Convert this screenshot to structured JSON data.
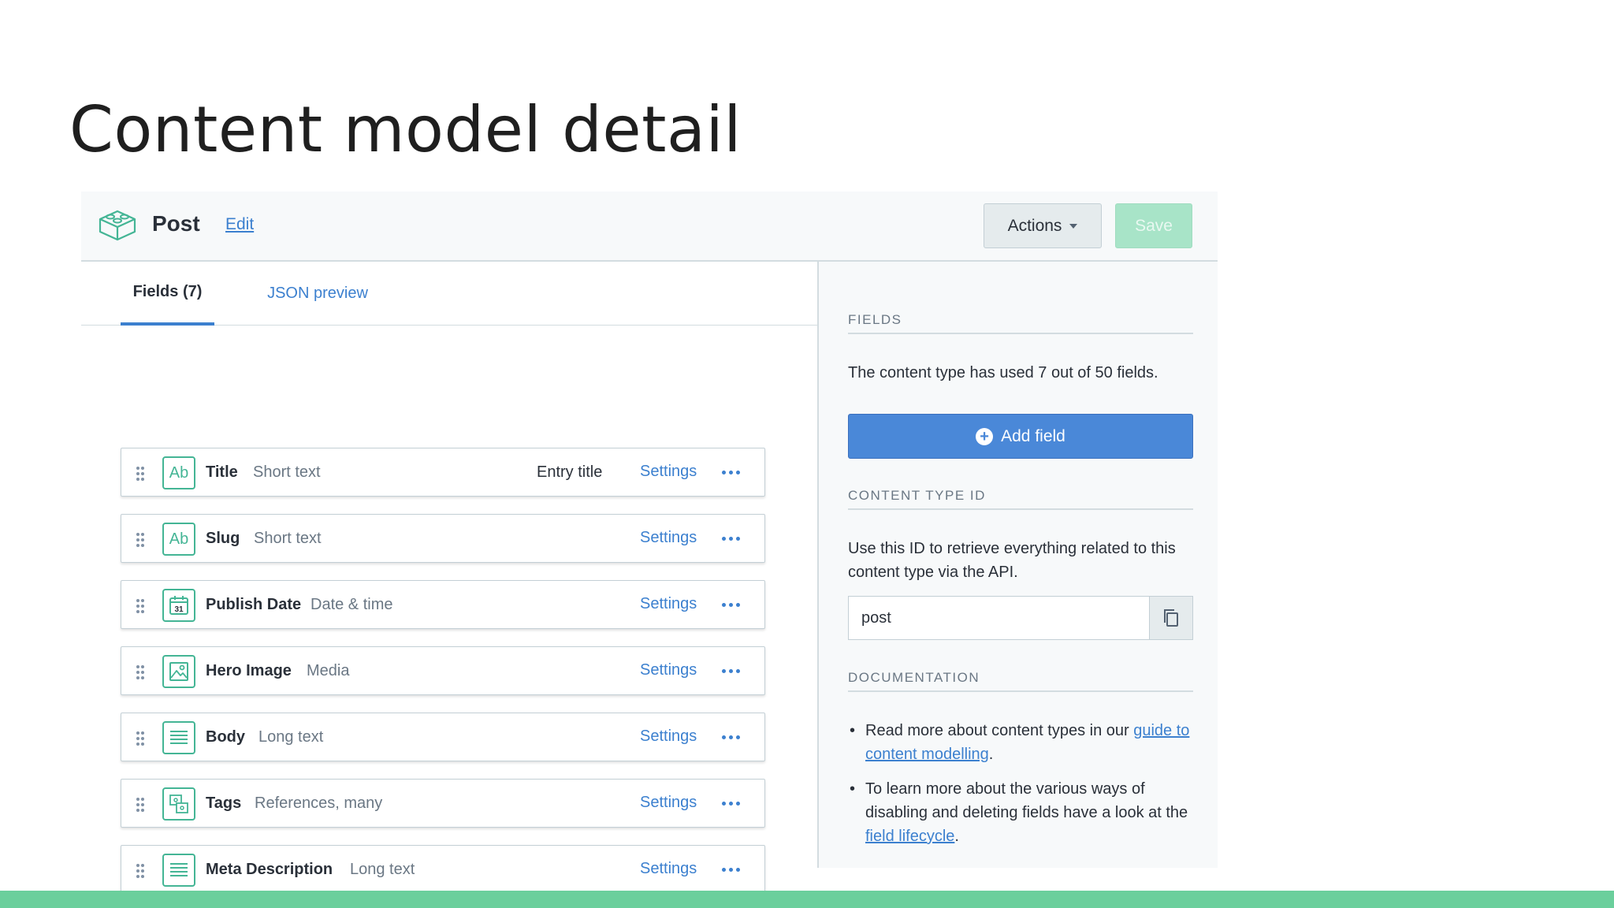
{
  "slide": {
    "title": "Content model detail"
  },
  "header": {
    "content_type_name": "Post",
    "edit_label": "Edit",
    "actions_label": "Actions",
    "save_label": "Save"
  },
  "tabs": [
    {
      "label": "Fields (7)",
      "active": true
    },
    {
      "label": "JSON preview",
      "active": false
    }
  ],
  "fields": [
    {
      "name": "Title",
      "type": "Short text",
      "icon": "short-text-icon",
      "tag": "Entry title",
      "settings": "Settings"
    },
    {
      "name": "Slug",
      "type": "Short text",
      "icon": "short-text-icon",
      "tag": "",
      "settings": "Settings"
    },
    {
      "name": "Publish Date",
      "type": "Date & time",
      "icon": "calendar-icon",
      "tag": "",
      "settings": "Settings"
    },
    {
      "name": "Hero Image",
      "type": "Media",
      "icon": "media-icon",
      "tag": "",
      "settings": "Settings"
    },
    {
      "name": "Body",
      "type": "Long text",
      "icon": "long-text-icon",
      "tag": "",
      "settings": "Settings"
    },
    {
      "name": "Tags",
      "type": "References, many",
      "icon": "references-icon",
      "tag": "",
      "settings": "Settings"
    },
    {
      "name": "Meta Description",
      "type": "Long text",
      "icon": "long-text-icon",
      "tag": "",
      "settings": "Settings"
    }
  ],
  "icons": {
    "short_text_glyph": "Ab",
    "calendar_glyph": "31"
  },
  "sidebar": {
    "fields_heading": "FIELDS",
    "fields_usage": "The content type has used 7 out of 50 fields.",
    "add_field_label": "Add field",
    "content_type_id_heading": "CONTENT TYPE ID",
    "content_type_id_help": "Use this ID to retrieve everything related to this content type via the API.",
    "content_type_id_value": "post",
    "documentation_heading": "DOCUMENTATION",
    "doc_item_1_text": "Read more about content types in our ",
    "doc_item_1_link": "guide to content modelling",
    "doc_item_1_end": ".",
    "doc_item_2_text": "To learn more about the various ways of disabling and deleting fields have a look at the ",
    "doc_item_2_link": "field lifecycle",
    "doc_item_2_end": "."
  },
  "colors": {
    "accent_blue": "#3c80cf",
    "brand_green": "#44b595",
    "bottom_bar": "#6bcf9c",
    "save_disabled": "#a8e4c8"
  }
}
